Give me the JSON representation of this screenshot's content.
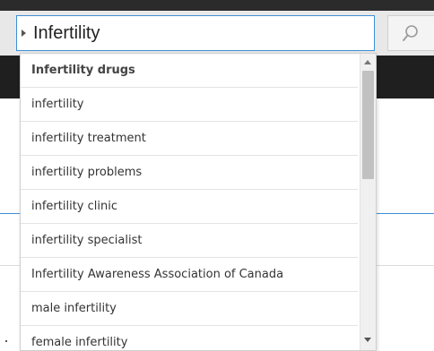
{
  "search": {
    "value": "Infertility",
    "button_icon": "search-icon"
  },
  "suggestions": [
    {
      "label": "Infertility drugs",
      "bold": true
    },
    {
      "label": "infertility"
    },
    {
      "label": "infertility treatment"
    },
    {
      "label": "infertility problems"
    },
    {
      "label": "infertility clinic"
    },
    {
      "label": "infertility specialist"
    },
    {
      "label": "Infertility Awareness Association of Canada"
    },
    {
      "label": "male infertility"
    },
    {
      "label": "female infertility"
    }
  ],
  "scrollbar": {
    "position": 0.0,
    "visible_fraction": 0.4
  },
  "colors": {
    "focus_border": "#3c8fd8",
    "header_dark": "#1f1f1f"
  }
}
